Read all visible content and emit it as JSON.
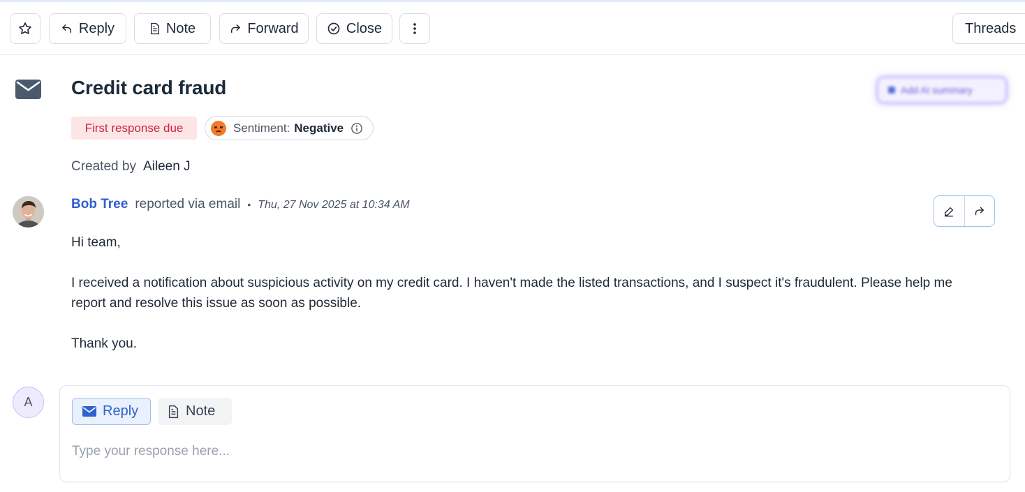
{
  "toolbar": {
    "reply_label": "Reply",
    "note_label": "Note",
    "forward_label": "Forward",
    "close_label": "Close",
    "threads_label": "Threads"
  },
  "conversation": {
    "title": "Credit card fraud",
    "ai_summary_label": "Add AI summary",
    "sla_badge": "First response due",
    "sentiment_label": "Sentiment:",
    "sentiment_value": "Negative",
    "created_by_label": "Created by",
    "created_by_name": "Aileen J"
  },
  "message": {
    "sender": "Bob Tree",
    "channel_text": "reported via email",
    "separator": "•",
    "timestamp": "Thu, 27 Nov 2025 at 10:34 AM",
    "body": [
      "Hi team,",
      "I received a notification about suspicious activity on my credit card. I haven't made the listed transactions, and I suspect it's fraudulent. Please help me report and resolve this issue as soon as possible.",
      "Thank you."
    ]
  },
  "composer": {
    "avatar_initial": "A",
    "reply_tab": "Reply",
    "note_tab": "Note",
    "placeholder": "Type your response here..."
  },
  "colors": {
    "accent": "#2f5fd0",
    "badge_bg": "#fde5e7",
    "badge_text": "#c8283a",
    "sentiment_emoji": "#f07b2e"
  },
  "icons": {
    "star": "star-icon",
    "reply": "reply-arrow-icon",
    "note": "document-icon",
    "forward": "forward-arrow-icon",
    "close": "check-circle-icon",
    "more": "vertical-dots-icon",
    "mail": "envelope-icon",
    "sentiment": "angry-face-icon",
    "info": "info-circle-icon",
    "edit": "pencil-icon",
    "forward_message": "forward-arrow-icon"
  }
}
